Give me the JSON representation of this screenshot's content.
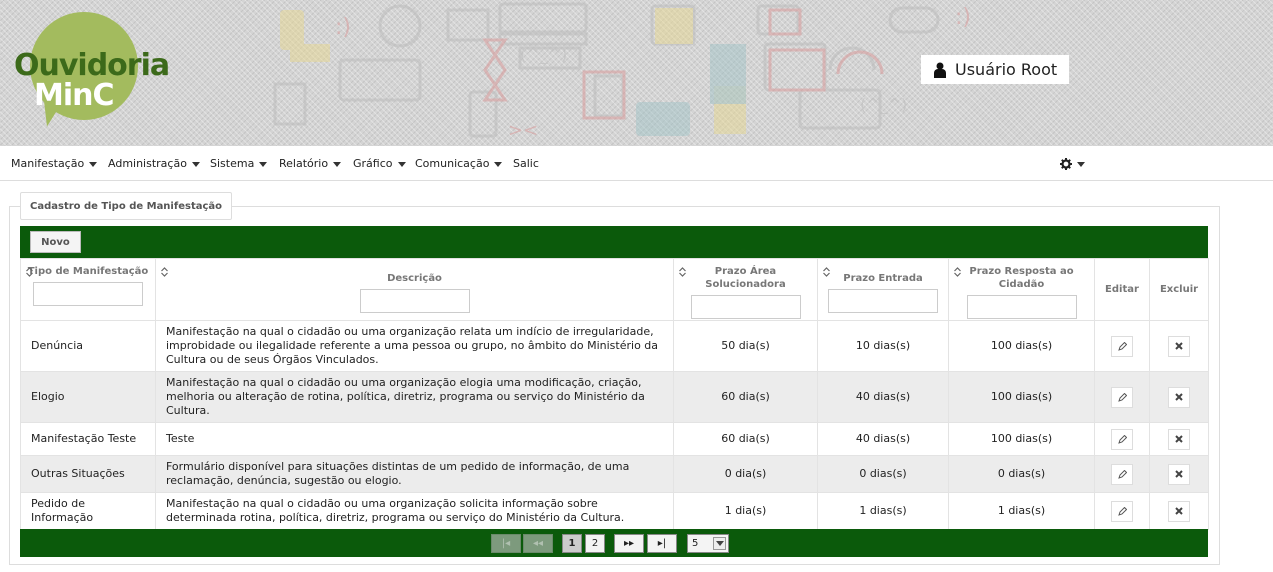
{
  "header": {
    "logo_line1": "Ouvidoria",
    "logo_line2": "MinC",
    "user_name": "Usuário Root"
  },
  "nav": {
    "items": [
      {
        "label": "Manifestação",
        "has_caret": true
      },
      {
        "label": "Administração",
        "has_caret": true
      },
      {
        "label": "Sistema",
        "has_caret": true
      },
      {
        "label": "Relatório",
        "has_caret": true
      },
      {
        "label": "Gráfico",
        "has_caret": true
      },
      {
        "label": "Comunicação",
        "has_caret": true
      },
      {
        "label": "Salic",
        "has_caret": false
      }
    ],
    "settings_icon": "gear-icon"
  },
  "panel": {
    "legend": "Cadastro de Tipo de Manifestação",
    "new_button": "Novo"
  },
  "table": {
    "headers": {
      "tipo": "Tipo de Manifestação",
      "descricao": "Descrição",
      "prazo_area": "Prazo Área Solucionadora",
      "prazo_entrada": "Prazo Entrada",
      "prazo_resposta": "Prazo Resposta ao Cidadão",
      "editar": "Editar",
      "excluir": "Excluir"
    },
    "rows": [
      {
        "tipo": "Denúncia",
        "descricao": "Manifestação na qual o cidadão ou uma organização relata um indício de irregularidade, improbidade ou ilegalidade referente a uma pessoa ou grupo, no âmbito do Ministério da Cultura ou de seus Órgãos Vinculados.",
        "prazo_area": "50 dia(s)",
        "prazo_entrada": "10 dias(s)",
        "prazo_resposta": "100 dias(s)"
      },
      {
        "tipo": "Elogio",
        "descricao": "Manifestação na qual o cidadão ou uma organização elogia uma modificação, criação, melhoria ou alteração de rotina, política, diretriz, programa ou serviço do Ministério da Cultura.",
        "prazo_area": "60 dia(s)",
        "prazo_entrada": "40 dias(s)",
        "prazo_resposta": "100 dias(s)"
      },
      {
        "tipo": "Manifestação Teste",
        "descricao": "Teste",
        "prazo_area": "60 dia(s)",
        "prazo_entrada": "40 dias(s)",
        "prazo_resposta": "100 dias(s)"
      },
      {
        "tipo": "Outras Situações",
        "descricao": "Formulário disponível para situações distintas de um pedido de informação, de uma reclamação, denúncia, sugestão ou elogio.",
        "prazo_area": "0 dia(s)",
        "prazo_entrada": "0 dias(s)",
        "prazo_resposta": "0 dias(s)"
      },
      {
        "tipo": "Pedido de Informação",
        "descricao": "Manifestação na qual o cidadão ou uma organização solicita informação sobre determinada rotina, política, diretriz, programa ou serviço do Ministério da Cultura.",
        "prazo_area": "1 dia(s)",
        "prazo_entrada": "1 dias(s)",
        "prazo_resposta": "1 dias(s)"
      }
    ]
  },
  "pager": {
    "first": "|◂",
    "prev": "◂◂",
    "pages": [
      "1",
      "2"
    ],
    "current_page": "1",
    "next": "▸▸",
    "last": "▸|",
    "page_size": "5"
  },
  "colors": {
    "toolbar_green": "#0b5a0b",
    "logo_dark_green": "#3c6a1a",
    "logo_light_green": "#a3bb5e"
  }
}
